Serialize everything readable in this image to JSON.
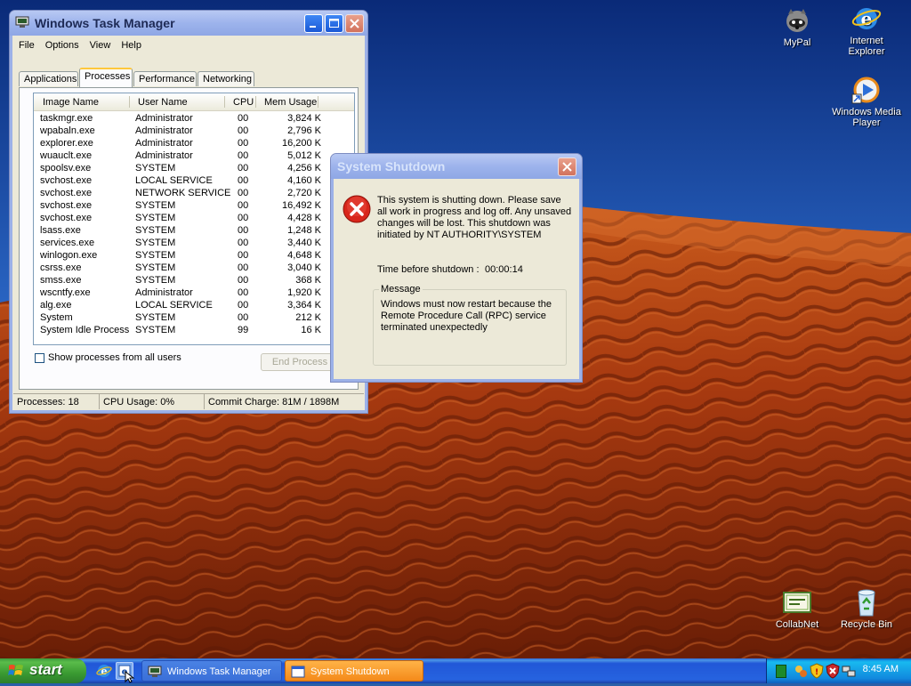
{
  "desktop": {
    "icons": [
      {
        "label": "MyPal"
      },
      {
        "label": "Internet Explorer"
      },
      {
        "label": "Windows Media Player"
      },
      {
        "label": "CollabNet"
      },
      {
        "label": "Recycle Bin"
      }
    ]
  },
  "task_manager": {
    "title": "Windows Task Manager",
    "menu": [
      "File",
      "Options",
      "View",
      "Help"
    ],
    "tabs": [
      "Applications",
      "Processes",
      "Performance",
      "Networking"
    ],
    "active_tab": "Processes",
    "columns": [
      "Image Name",
      "User Name",
      "CPU",
      "Mem Usage"
    ],
    "processes": [
      {
        "name": "taskmgr.exe",
        "user": "Administrator",
        "cpu": "00",
        "mem": "3,824 K"
      },
      {
        "name": "wpabaln.exe",
        "user": "Administrator",
        "cpu": "00",
        "mem": "2,796 K"
      },
      {
        "name": "explorer.exe",
        "user": "Administrator",
        "cpu": "00",
        "mem": "16,200 K"
      },
      {
        "name": "wuauclt.exe",
        "user": "Administrator",
        "cpu": "00",
        "mem": "5,012 K"
      },
      {
        "name": "spoolsv.exe",
        "user": "SYSTEM",
        "cpu": "00",
        "mem": "4,256 K"
      },
      {
        "name": "svchost.exe",
        "user": "LOCAL SERVICE",
        "cpu": "00",
        "mem": "4,160 K"
      },
      {
        "name": "svchost.exe",
        "user": "NETWORK SERVICE",
        "cpu": "00",
        "mem": "2,720 K"
      },
      {
        "name": "svchost.exe",
        "user": "SYSTEM",
        "cpu": "00",
        "mem": "16,492 K"
      },
      {
        "name": "svchost.exe",
        "user": "SYSTEM",
        "cpu": "00",
        "mem": "4,428 K"
      },
      {
        "name": "lsass.exe",
        "user": "SYSTEM",
        "cpu": "00",
        "mem": "1,248 K"
      },
      {
        "name": "services.exe",
        "user": "SYSTEM",
        "cpu": "00",
        "mem": "3,440 K"
      },
      {
        "name": "winlogon.exe",
        "user": "SYSTEM",
        "cpu": "00",
        "mem": "4,648 K"
      },
      {
        "name": "csrss.exe",
        "user": "SYSTEM",
        "cpu": "00",
        "mem": "3,040 K"
      },
      {
        "name": "smss.exe",
        "user": "SYSTEM",
        "cpu": "00",
        "mem": "368 K"
      },
      {
        "name": "wscntfy.exe",
        "user": "Administrator",
        "cpu": "00",
        "mem": "1,920 K"
      },
      {
        "name": "alg.exe",
        "user": "LOCAL SERVICE",
        "cpu": "00",
        "mem": "3,364 K"
      },
      {
        "name": "System",
        "user": "SYSTEM",
        "cpu": "00",
        "mem": "212 K"
      },
      {
        "name": "System Idle Process",
        "user": "SYSTEM",
        "cpu": "99",
        "mem": "16 K"
      }
    ],
    "show_all_users_label": "Show processes from all users",
    "end_process_label": "End Process",
    "status": {
      "processes": "Processes: 18",
      "cpu": "CPU Usage: 0%",
      "commit": "Commit Charge: 81M / 1898M"
    }
  },
  "shutdown_dialog": {
    "title": "System Shutdown",
    "warning": "This system is shutting down. Please save all work in progress and log off. Any unsaved changes will be lost. This shutdown was initiated by NT AUTHORITY\\SYSTEM",
    "time_label": "Time before shutdown :",
    "time_value": "00:00:14",
    "message_label": "Message",
    "message": "Windows must now restart because the Remote Procedure Call (RPC) service terminated unexpectedly"
  },
  "taskbar": {
    "start_label": "start",
    "items": [
      "Windows Task Manager",
      "System Shutdown"
    ],
    "clock": "8:45 AM"
  },
  "colors": {
    "titlebar_active": "#0552d8",
    "window_face": "#ece9d8",
    "taskbar": "#2663e0",
    "start_green": "#3a9a32",
    "dune": "#b8410f"
  }
}
